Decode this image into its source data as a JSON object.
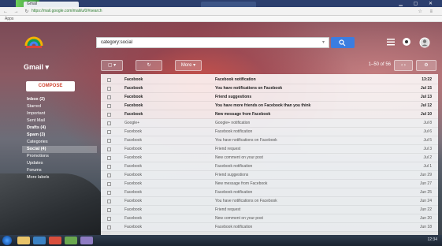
{
  "browser": {
    "tab_title": "Gmail",
    "url": "https://mail.google.com/mail/u/0/#search",
    "bookmarks_label": "Apps"
  },
  "gmail": {
    "search": {
      "value": "category:social"
    },
    "mail_label": "Gmail",
    "compose_label": "COMPOSE",
    "toolbar": {
      "more_label": "More",
      "paging": "1–50 of 56"
    },
    "sidebar": [
      {
        "label": "Inbox (2)",
        "bold": true,
        "active": false
      },
      {
        "label": "Starred",
        "bold": false,
        "active": false
      },
      {
        "label": "Important",
        "bold": false,
        "active": false
      },
      {
        "label": "Sent Mail",
        "bold": false,
        "active": false
      },
      {
        "label": "Drafts (4)",
        "bold": true,
        "active": false
      },
      {
        "label": "Spam (3)",
        "bold": true,
        "active": false
      },
      {
        "label": "Categories",
        "bold": false,
        "active": false
      },
      {
        "label": "Social (4)",
        "bold": true,
        "active": true
      },
      {
        "label": "Promotions",
        "bold": false,
        "active": false
      },
      {
        "label": "Updates",
        "bold": false,
        "active": false
      },
      {
        "label": "Forums",
        "bold": false,
        "active": false
      },
      {
        "label": "More labels",
        "bold": false,
        "active": false
      }
    ],
    "emails": [
      {
        "sender": "Facebook",
        "subject": "Facebook notification",
        "date": "13:22",
        "unread": true
      },
      {
        "sender": "Facebook",
        "subject": "You have notifications on Facebook",
        "date": "Jul 15",
        "unread": true
      },
      {
        "sender": "Facebook",
        "subject": "Friend suggestions",
        "date": "Jul 13",
        "unread": true
      },
      {
        "sender": "Facebook",
        "subject": "You have more friends on Facebook than you think",
        "date": "Jul 12",
        "unread": true
      },
      {
        "sender": "Facebook",
        "subject": "New message from Facebook",
        "date": "Jul 10",
        "unread": true
      },
      {
        "sender": "Google+",
        "subject": "Google+ notification",
        "date": "Jul 8",
        "unread": false
      },
      {
        "sender": "Facebook",
        "subject": "Facebook notification",
        "date": "Jul 6",
        "unread": false
      },
      {
        "sender": "Facebook",
        "subject": "You have notifications on Facebook",
        "date": "Jul 5",
        "unread": false
      },
      {
        "sender": "Facebook",
        "subject": "Friend request",
        "date": "Jul 3",
        "unread": false
      },
      {
        "sender": "Facebook",
        "subject": "New comment on your post",
        "date": "Jul 2",
        "unread": false
      },
      {
        "sender": "Facebook",
        "subject": "Facebook notification",
        "date": "Jul 1",
        "unread": false
      },
      {
        "sender": "Facebook",
        "subject": "Friend suggestions",
        "date": "Jun 29",
        "unread": false
      },
      {
        "sender": "Facebook",
        "subject": "New message from Facebook",
        "date": "Jun 27",
        "unread": false
      },
      {
        "sender": "Facebook",
        "subject": "Facebook notification",
        "date": "Jun 25",
        "unread": false
      },
      {
        "sender": "Facebook",
        "subject": "You have notifications on Facebook",
        "date": "Jun 24",
        "unread": false
      },
      {
        "sender": "Facebook",
        "subject": "Friend request",
        "date": "Jun 22",
        "unread": false
      },
      {
        "sender": "Facebook",
        "subject": "New comment on your post",
        "date": "Jun 20",
        "unread": false
      },
      {
        "sender": "Facebook",
        "subject": "Facebook notification",
        "date": "Jun 18",
        "unread": false
      }
    ]
  },
  "taskbar": {
    "clock": "12:34"
  }
}
